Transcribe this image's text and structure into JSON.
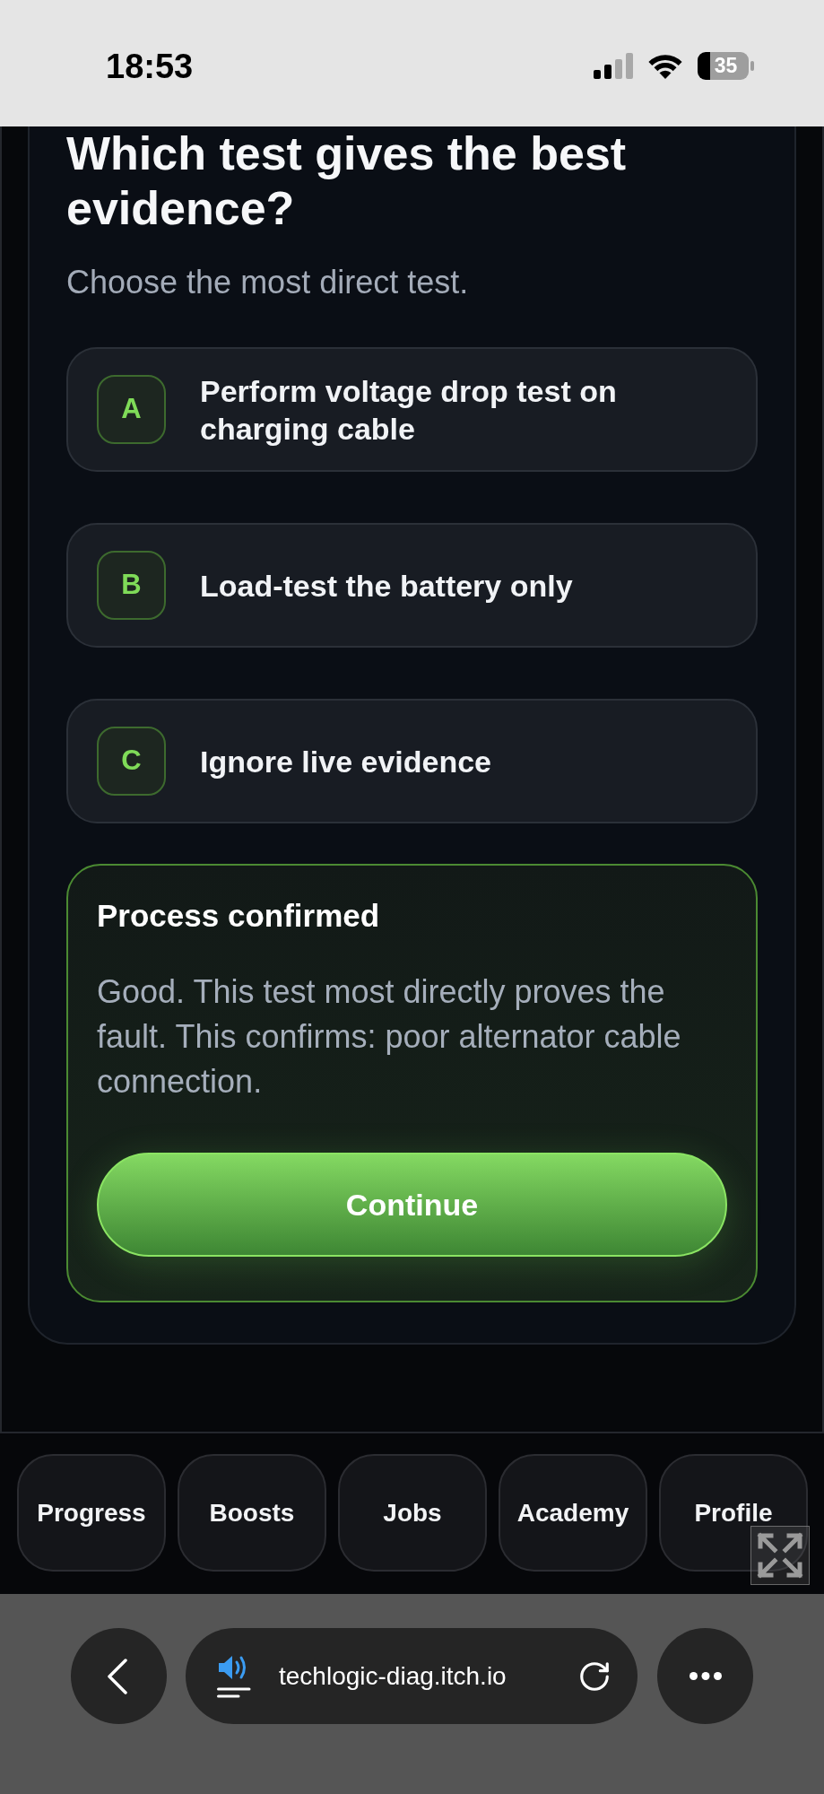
{
  "status_bar": {
    "time": "18:53",
    "battery": "35"
  },
  "question": {
    "title": "Which test gives the best evidence?",
    "subtitle": "Choose the most direct test."
  },
  "options": [
    {
      "letter": "A",
      "text": "Perform voltage drop test on charging cable",
      "selected": false
    },
    {
      "letter": "B",
      "text": "Load-test the battery only",
      "selected": false
    },
    {
      "letter": "C",
      "text": "Ignore live evidence",
      "selected": false
    }
  ],
  "feedback": {
    "title": "Process confirmed",
    "message": "Good. This test most directly proves the fault. This confirms: poor alternator cable connection.",
    "button": "Continue"
  },
  "nav": [
    {
      "label": "Progress",
      "selected": false
    },
    {
      "label": "Boosts",
      "selected": false
    },
    {
      "label": "Jobs",
      "selected": false
    },
    {
      "label": "Academy",
      "selected": false
    },
    {
      "label": "Profile",
      "selected": false
    }
  ],
  "browser": {
    "url": "techlogic-diag.itch.io"
  }
}
